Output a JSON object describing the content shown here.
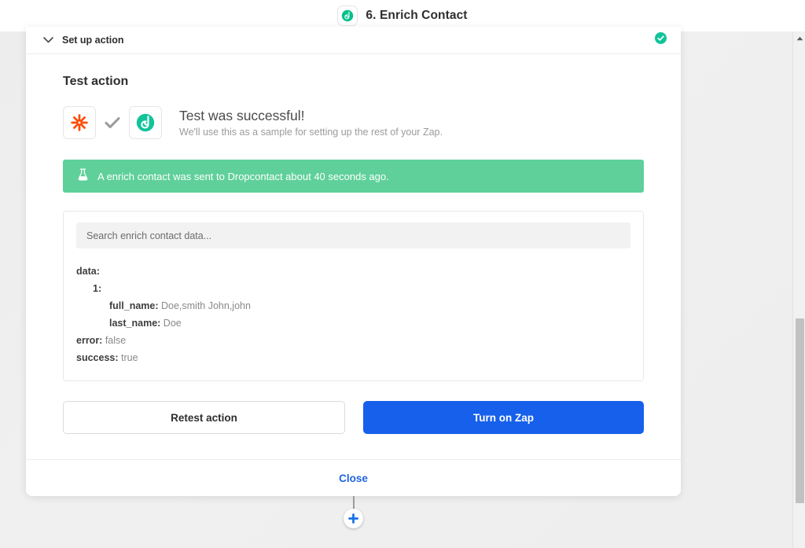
{
  "topbar": {
    "step_logo_icon": "dropcontact-logo-icon",
    "step_title": "6. Enrich Contact"
  },
  "card": {
    "header": {
      "chevron_icon": "chevron-down-icon",
      "title": "Set up action",
      "status_icon": "check-circle-icon"
    },
    "section_title": "Test action",
    "result": {
      "left_app_icon": "zapier-logo-icon",
      "tick_icon": "checkmark-icon",
      "right_app_icon": "dropcontact-logo-icon",
      "heading": "Test was successful!",
      "subtext": "We'll use this as a sample for setting up the rest of your Zap."
    },
    "banner": {
      "icon": "flask-icon",
      "text": "A enrich contact was sent to Dropcontact about 40 seconds ago.",
      "color": "#5fd09a"
    },
    "data_panel": {
      "search_placeholder": "Search enrich contact data...",
      "search_value": "",
      "rows": [
        {
          "indent": 0,
          "key": "data:",
          "value": ""
        },
        {
          "indent": 1,
          "key": "1:",
          "value": ""
        },
        {
          "indent": 2,
          "key": "full_name:",
          "value": "Doe,smith John,john"
        },
        {
          "indent": 2,
          "key": "last_name:",
          "value": "Doe"
        },
        {
          "indent": 0,
          "key": "error:",
          "value": "false"
        },
        {
          "indent": 0,
          "key": "success:",
          "value": "true"
        }
      ]
    },
    "buttons": {
      "retest_label": "Retest action",
      "turn_on_label": "Turn on Zap",
      "primary_color": "#1660eb"
    },
    "footer": {
      "close_label": "Close"
    }
  },
  "canvas": {
    "add_step_icon": "plus-icon"
  },
  "scrollbar": {
    "up_arrow_icon": "caret-up-icon"
  }
}
